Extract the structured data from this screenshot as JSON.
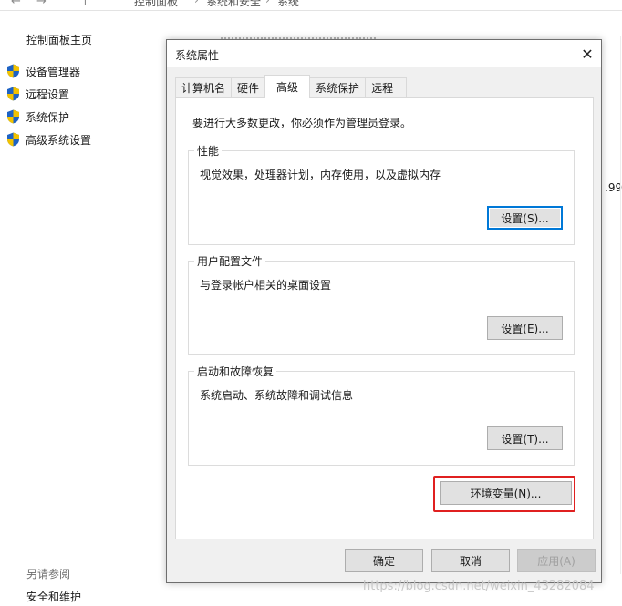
{
  "background": {
    "breadcrumb": [
      "控制面板",
      "系统和安全",
      "系统"
    ],
    "sidebar_home": "控制面板主页",
    "sidebar_links": [
      "设备管理器",
      "远程设置",
      "系统保护",
      "高级系统设置"
    ],
    "see_also_heading": "另请参阅",
    "see_also_link": "安全和维护",
    "right_partial_value": ".99"
  },
  "dialog": {
    "title": "系统属性",
    "close_glyph": "✕",
    "tabs": [
      "计算机名",
      "硬件",
      "高级",
      "系统保护",
      "远程"
    ],
    "active_tab": "高级",
    "admin_note": "要进行大多数更改，你必须作为管理员登录。",
    "groups": {
      "performance": {
        "title": "性能",
        "description": "视觉效果，处理器计划，内存使用，以及虚拟内存",
        "button": "设置(S)..."
      },
      "user_profiles": {
        "title": "用户配置文件",
        "description": "与登录帐户相关的桌面设置",
        "button": "设置(E)..."
      },
      "startup_recovery": {
        "title": "启动和故障恢复",
        "description": "系统启动、系统故障和调试信息",
        "button": "设置(T)..."
      }
    },
    "env_button": "环境变量(N)...",
    "ok_button": "确定",
    "cancel_button": "取消",
    "apply_button": "应用(A)"
  },
  "watermark": "https://blog.csdn.net/weixin_43282084",
  "colors": {
    "accent": "#0078d7",
    "highlight": "#e02020",
    "shield_blue": "#1e63c4",
    "shield_yellow": "#f2c200"
  }
}
